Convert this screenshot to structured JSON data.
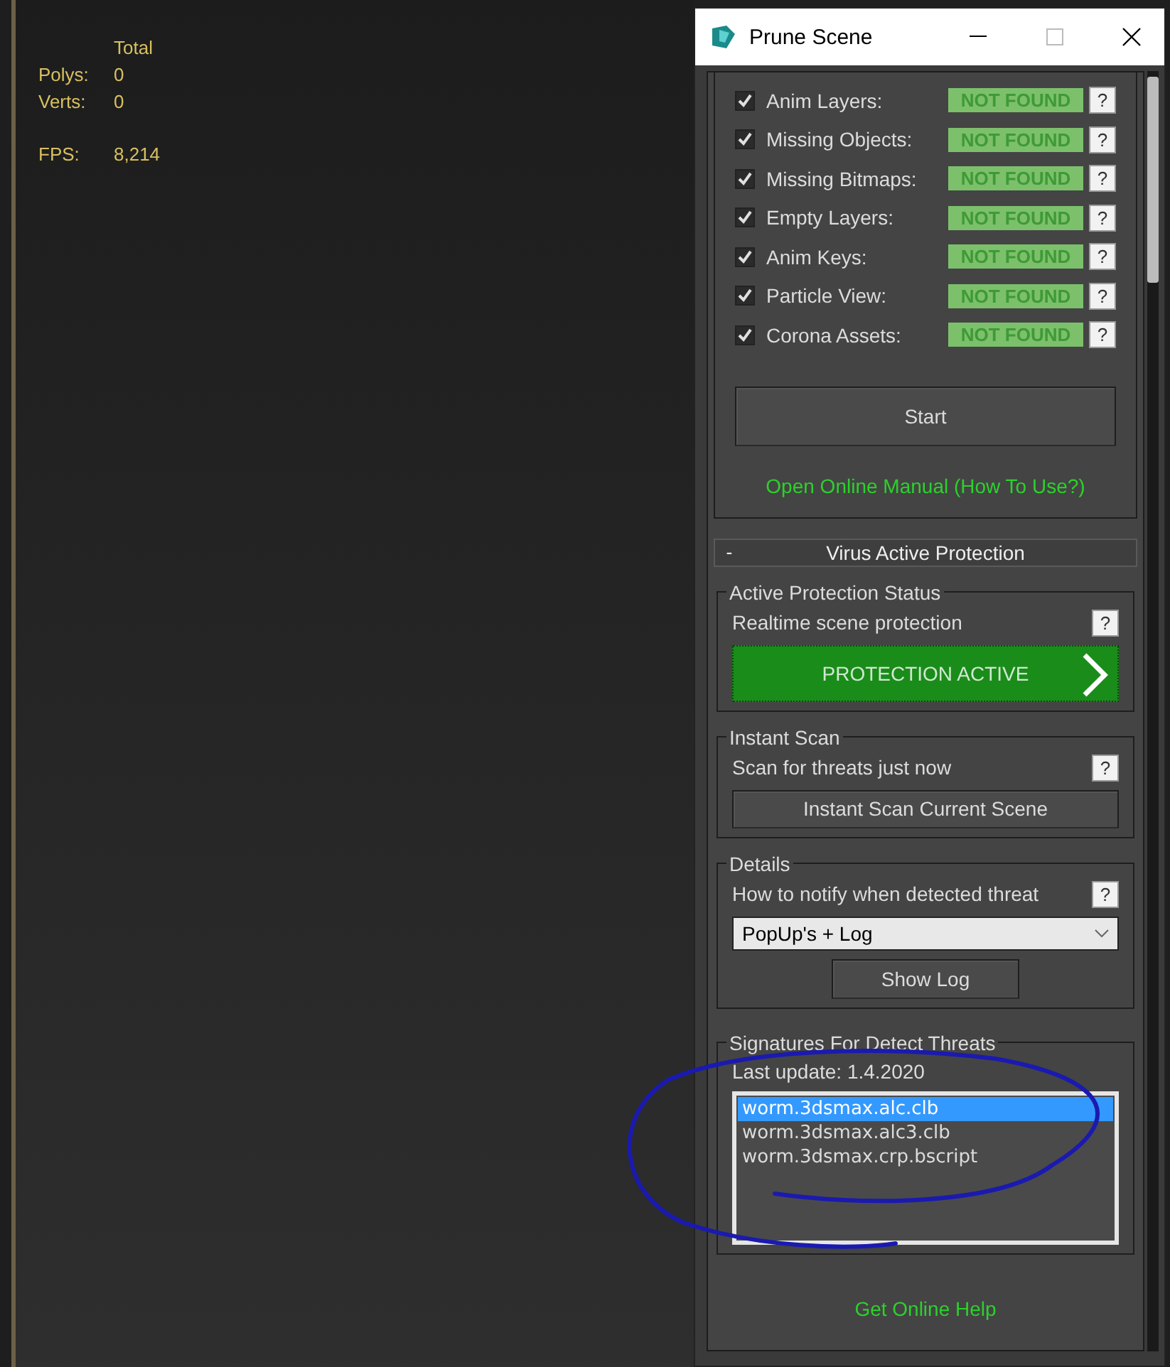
{
  "viewport": {
    "stats_header": "Total",
    "stats": [
      {
        "label": "Polys:",
        "value": "0"
      },
      {
        "label": "Verts:",
        "value": "0"
      }
    ],
    "fps": {
      "label": "FPS:",
      "value": "8,214"
    }
  },
  "window": {
    "title": "Prune Scene"
  },
  "prune_items": [
    {
      "label": "Anim Layers:",
      "checked": true,
      "status": "NOT FOUND",
      "help": "?"
    },
    {
      "label": "Missing Objects:",
      "checked": true,
      "status": "NOT FOUND",
      "help": "?"
    },
    {
      "label": "Missing Bitmaps:",
      "checked": true,
      "status": "NOT FOUND",
      "help": "?"
    },
    {
      "label": "Empty Layers:",
      "checked": true,
      "status": "NOT FOUND",
      "help": "?"
    },
    {
      "label": "Anim Keys:",
      "checked": true,
      "status": "NOT FOUND",
      "help": "?"
    },
    {
      "label": "Particle View:",
      "checked": true,
      "status": "NOT FOUND",
      "help": "?"
    },
    {
      "label": "Corona Assets:",
      "checked": true,
      "status": "NOT FOUND",
      "help": "?"
    }
  ],
  "start_button": "Start",
  "manual_link": "Open Online Manual (How To Use?)",
  "rollout": {
    "toggle": "-",
    "title": "Virus Active Protection",
    "expanded": true
  },
  "protection": {
    "group_title": "Active Protection Status",
    "label": "Realtime scene protection",
    "help": "?",
    "button": "PROTECTION ACTIVE",
    "active": true
  },
  "instant_scan": {
    "group_title": "Instant Scan",
    "label": "Scan for threats just now",
    "help": "?",
    "button": "Instant Scan Current Scene"
  },
  "details": {
    "group_title": "Details",
    "label": "How to notify when detected threat",
    "help": "?",
    "notify_value": "PopUp's + Log",
    "button": "Show Log"
  },
  "signatures": {
    "group_title": "Signatures For Detect Threats",
    "last_update": "Last update: 1.4.2020",
    "items": [
      {
        "name": "worm.3dsmax.alc.clb",
        "selected": true
      },
      {
        "name": "worm.3dsmax.alc3.clb",
        "selected": false
      },
      {
        "name": "worm.3dsmax.crp.bscript",
        "selected": false
      }
    ]
  },
  "help_link": "Get Online Help"
}
